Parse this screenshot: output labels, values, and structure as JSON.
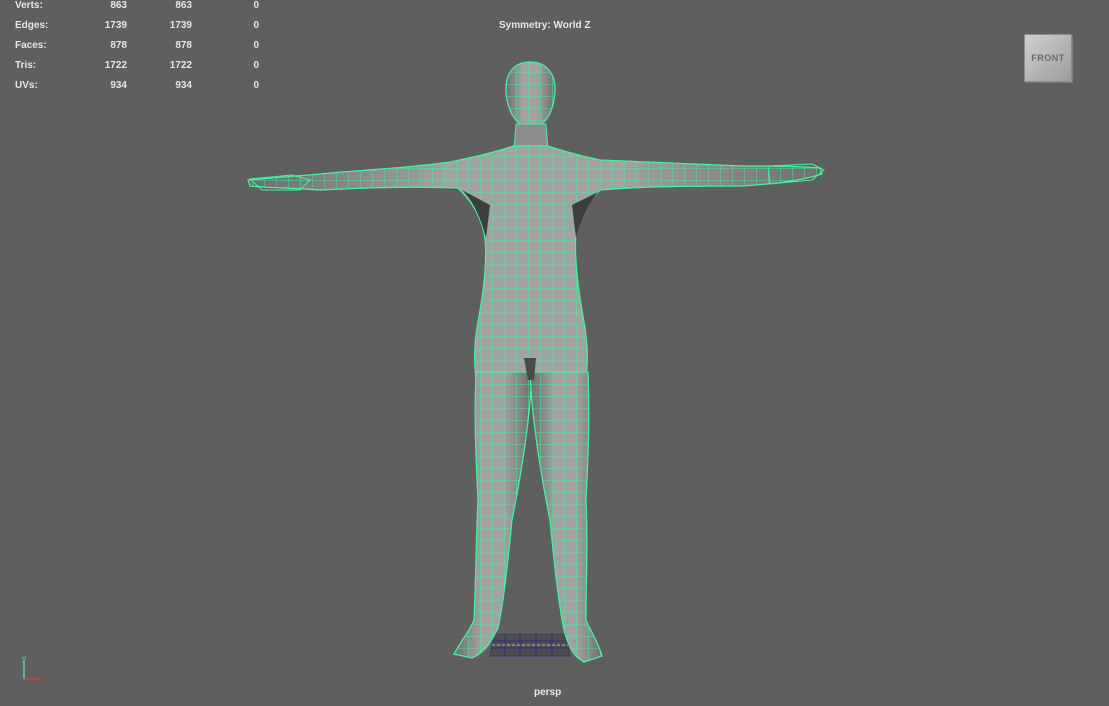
{
  "hud": {
    "rows": [
      {
        "label": "Verts:",
        "v1": "863",
        "v2": "863",
        "v3": "0"
      },
      {
        "label": "Edges:",
        "v1": "1739",
        "v2": "1739",
        "v3": "0"
      },
      {
        "label": "Faces:",
        "v1": "878",
        "v2": "878",
        "v3": "0"
      },
      {
        "label": "Tris:",
        "v1": "1722",
        "v2": "1722",
        "v3": "0"
      },
      {
        "label": "UVs:",
        "v1": "934",
        "v2": "934",
        "v3": "0"
      }
    ]
  },
  "symmetry": "Symmetry: World Z",
  "viewcube": {
    "face": "FRONT"
  },
  "camera": "persp",
  "axis": {
    "y": "y",
    "x": "x"
  },
  "colors": {
    "background": "#5f5f5f",
    "wireframe": "#44f2a0",
    "mesh": "#9a9a9a",
    "mesh_shadow": "#4a4a4a"
  }
}
